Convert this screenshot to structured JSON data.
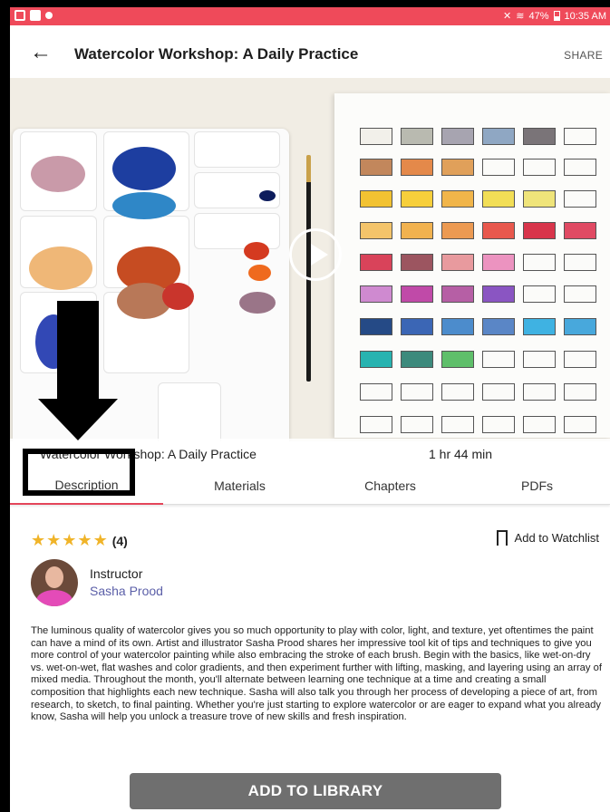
{
  "status_bar": {
    "battery": "47%",
    "time": "10:35 AM"
  },
  "app_bar": {
    "title": "Watercolor Workshop: A Daily Practice",
    "share_label": "SHARE"
  },
  "video": {
    "title": "Watercolor Workshop: A Daily Practice",
    "duration": "1 hr 44 min"
  },
  "tabs": [
    {
      "label": "Description",
      "active": true
    },
    {
      "label": "Materials",
      "active": false
    },
    {
      "label": "Chapters",
      "active": false
    },
    {
      "label": "PDFs",
      "active": false
    }
  ],
  "rating": {
    "stars": 5,
    "max_stars": 5,
    "count": "(4)"
  },
  "watchlist_label": "Add to Watchlist",
  "instructor": {
    "label": "Instructor",
    "name": "Sasha Prood"
  },
  "description": "The luminous quality of watercolor gives you so much opportunity to play with color, light, and texture, yet oftentimes the paint can have a mind of its own. Artist and illustrator Sasha Prood shares her impressive tool kit of tips and techniques to give you more control of your watercolor painting while also embracing the stroke of each brush. Begin with the basics, like wet-on-dry vs. wet-on-wet, flat washes and color gradients, and then experiment further with lifting, masking, and layering using an array of mixed media. Throughout the month, you'll alternate between learning one technique at a time and creating a small composition that highlights each new technique. Sasha will also talk you through her process of developing a piece of art, from research, to sketch, to final painting. Whether you're just starting to explore watercolor or are eager to expand what you already know, Sasha will help you unlock a treasure trove of new skills and fresh inspiration.",
  "add_button_label": "ADD TO LIBRARY",
  "colors": {
    "status_bar": "#ef4a5a",
    "tab_indicator": "#e4455a",
    "instructor_link": "#5b5fa8",
    "button_bg": "#6f6f6f",
    "star": "#f0b429"
  }
}
